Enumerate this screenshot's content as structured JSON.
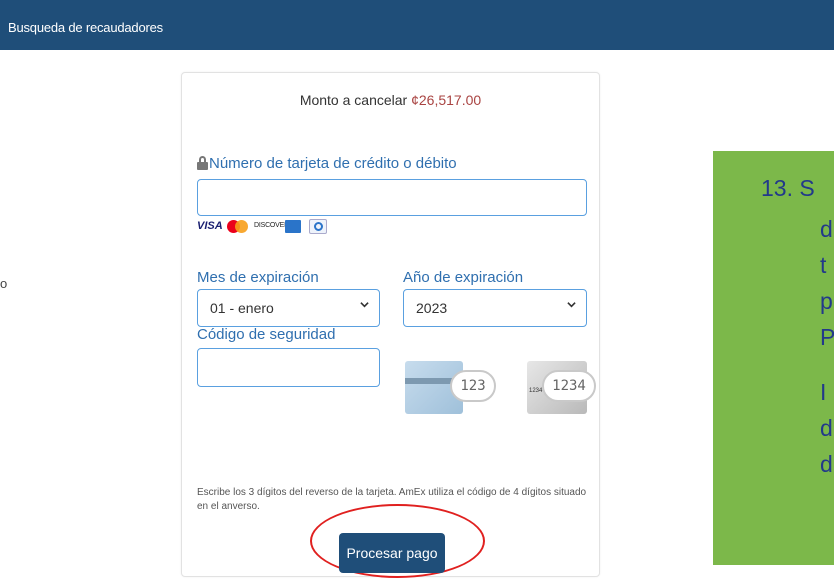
{
  "header": {
    "title": "Busqueda de recaudadores"
  },
  "left_fragment": "o",
  "form": {
    "amount_label": "Monto a cancelar",
    "amount_value": "¢26,517.00",
    "card_number_label": "Número de tarjeta de crédito o débito",
    "card_number_value": "",
    "brands": {
      "visa": "VISA",
      "discover": "DISCOVER"
    },
    "month_label": "Mes de expiración",
    "month_value": "01 - enero",
    "year_label": "Año de expiración",
    "year_value": "2023",
    "security_label": "Código de seguridad",
    "security_value": "",
    "cvv_example_1": "123",
    "cvv_example_2": "1234",
    "cvv_amex_small": "1234",
    "helper_text": "Escribe los 3 dígitos del reverso de la tarjeta. AmEx utiliza el código de 4 dígitos situado en el anverso.",
    "submit_label": "Procesar pago"
  },
  "side_note": {
    "number": "13. S",
    "fragments": [
      "d",
      "t",
      "p",
      "P",
      "I",
      "d",
      "d"
    ]
  },
  "colors": {
    "header_bg": "#1f4e79",
    "label_blue": "#2f6faf",
    "amount_red": "#a94442",
    "highlight_ellipse": "#e0201f",
    "note_bg": "#7cb84a",
    "note_text": "#22398a"
  }
}
